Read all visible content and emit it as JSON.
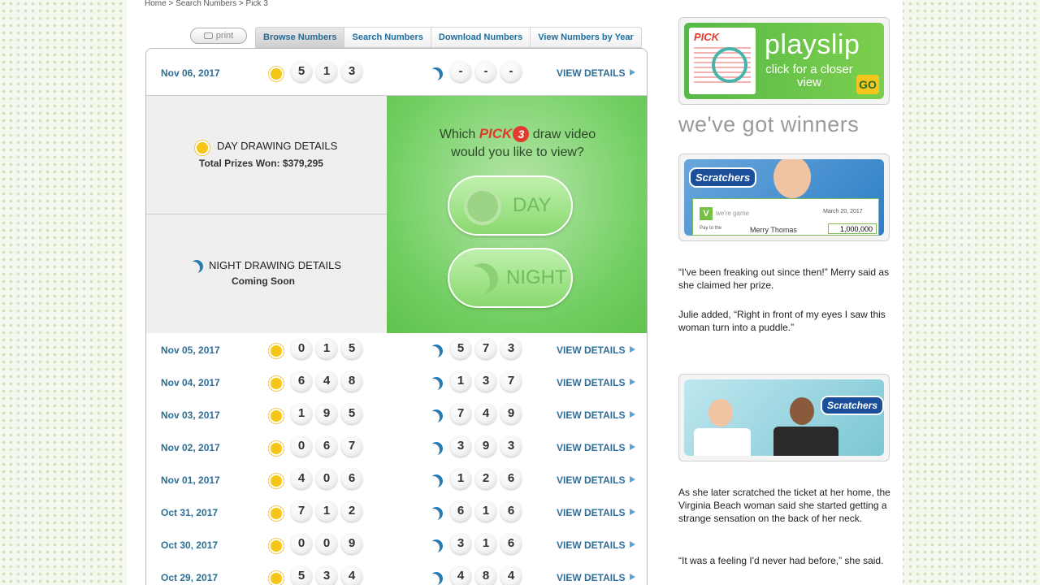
{
  "breadcrumb": [
    "Home",
    ">",
    "Search Numbers",
    ">",
    "Pick 3"
  ],
  "toolbar": {
    "print_label": "print"
  },
  "tabs": [
    "Browse Numbers",
    "Search Numbers",
    "Download Numbers",
    "View Numbers by Year"
  ],
  "view_details_label": "VIEW DETAILS",
  "latest": {
    "date": "Nov 06, 2017",
    "day": [
      "5",
      "1",
      "3"
    ],
    "night": [
      "-",
      "-",
      "-"
    ]
  },
  "day_details": {
    "title": "DAY DRAWING DETAILS",
    "subtitle": "Total Prizes Won: $379,295"
  },
  "night_details": {
    "title": "NIGHT DRAWING DETAILS",
    "subtitle": "Coming Soon"
  },
  "video_prompt": {
    "before": "Which",
    "game": "PICK",
    "game_digit": "3",
    "after": "draw video",
    "line2": "would you like to view?"
  },
  "video_buttons": {
    "day": "DAY",
    "night": "NIGHT"
  },
  "draws": [
    {
      "date": "Nov 05, 2017",
      "day": [
        "0",
        "1",
        "5"
      ],
      "night": [
        "5",
        "7",
        "3"
      ]
    },
    {
      "date": "Nov 04, 2017",
      "day": [
        "6",
        "4",
        "8"
      ],
      "night": [
        "1",
        "3",
        "7"
      ]
    },
    {
      "date": "Nov 03, 2017",
      "day": [
        "1",
        "9",
        "5"
      ],
      "night": [
        "7",
        "4",
        "9"
      ]
    },
    {
      "date": "Nov 02, 2017",
      "day": [
        "0",
        "6",
        "7"
      ],
      "night": [
        "3",
        "9",
        "3"
      ]
    },
    {
      "date": "Nov 01, 2017",
      "day": [
        "4",
        "0",
        "6"
      ],
      "night": [
        "1",
        "2",
        "6"
      ]
    },
    {
      "date": "Oct 31, 2017",
      "day": [
        "7",
        "1",
        "2"
      ],
      "night": [
        "6",
        "1",
        "6"
      ]
    },
    {
      "date": "Oct 30, 2017",
      "day": [
        "0",
        "0",
        "9"
      ],
      "night": [
        "3",
        "1",
        "6"
      ]
    },
    {
      "date": "Oct 29, 2017",
      "day": [
        "5",
        "3",
        "4"
      ],
      "night": [
        "4",
        "8",
        "4"
      ]
    }
  ],
  "sidebar": {
    "playslip": {
      "title": "playslip",
      "subtitle": "click for a closer view",
      "go": "GO",
      "ticket_logo": "PICK"
    },
    "winners_heading": "we've got winners",
    "scratchers_label": "Scratchers",
    "check": {
      "tagline": "we're game",
      "v": "V",
      "date": "March 20, 2017",
      "pay": "Pay to the",
      "payee": "Merry Thomas",
      "amount": "1,000,000"
    },
    "stories": [
      "“I've been freaking out since then!” Merry said as she claimed her prize.",
      "Julie added, “Right in front of my eyes I saw this woman turn into a puddle.”",
      "As she later scratched the ticket at her home, the Virginia Beach woman said she started getting a strange sensation on the back of her neck.",
      "“It was a feeling I'd never had before,” she said."
    ]
  },
  "colors": {
    "link_blue": "#2c6e96",
    "video_green": "#6fce5f",
    "pick3_red": "#e23b2e",
    "sun_yellow": "#f5c518",
    "moon_blue": "#2b7bb0"
  },
  "icons": {
    "day": "sun-icon",
    "night": "moon-icon",
    "arrow": "play-arrow-icon",
    "print": "printer-icon"
  }
}
